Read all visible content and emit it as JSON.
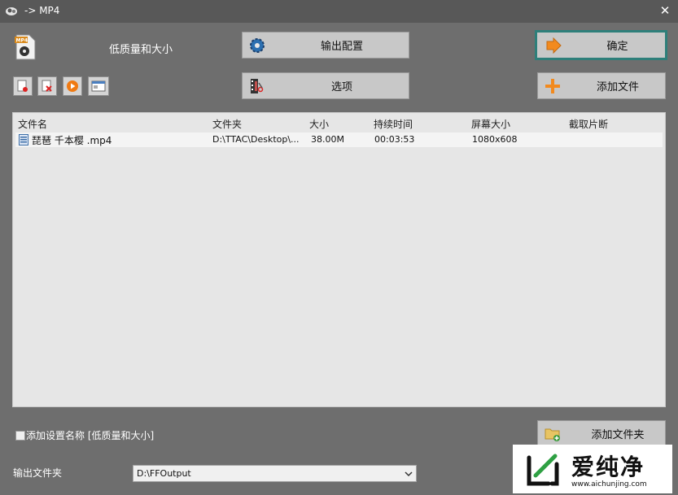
{
  "window": {
    "title": "-> MP4",
    "close_glyph": "✕"
  },
  "profile": {
    "label": "低质量和大小",
    "icon": "mp4-file-icon"
  },
  "buttons": {
    "output_config": "输出配置",
    "ok": "确定",
    "options": "选项",
    "add_file": "添加文件",
    "add_folder": "添加文件夹"
  },
  "mini_toolbar": [
    "remove-file-icon",
    "clear-list-icon",
    "play-icon",
    "media-info-icon"
  ],
  "list": {
    "columns": [
      "文件名",
      "文件夹",
      "大小",
      "持续时间",
      "屏幕大小",
      "截取片断"
    ],
    "rows": [
      {
        "name": "琵琶 千本樱 .mp4",
        "folder": "D:\\TTAC\\Desktop\\...",
        "size": "38.00M",
        "duration": "00:03:53",
        "screen": "1080x608",
        "clip": ""
      }
    ]
  },
  "footer": {
    "add_setting_name": "添加设置名称 [低质量和大小]",
    "output_folder_label": "输出文件夹",
    "output_folder_value": "D:\\FFOutput"
  },
  "watermark": {
    "name": "爱纯净",
    "url": "www.aichunjing.com"
  },
  "colors": {
    "accent_border": "#2e7f7a",
    "arrow_orange": "#f28a1e",
    "window_bg": "#6e6e6e"
  }
}
